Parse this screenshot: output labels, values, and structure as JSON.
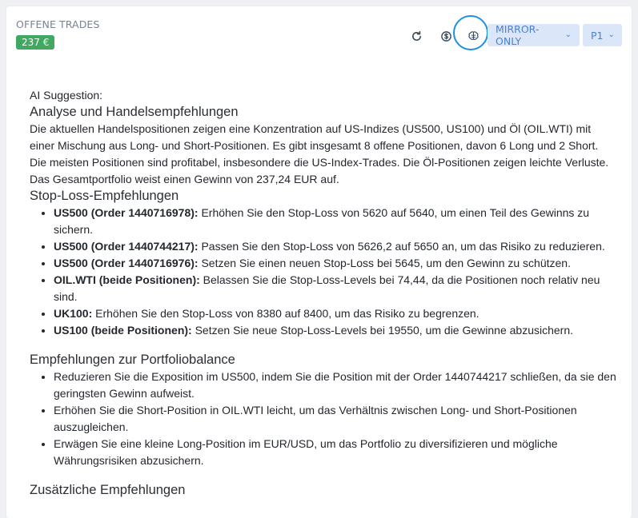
{
  "header": {
    "title": "OFFENE TRADES",
    "badge": "237 €"
  },
  "toolbar": {
    "refresh_icon": "refresh-icon",
    "currency_icon": "currency-exchange-icon",
    "ai_icon": "brain-ai-icon",
    "mode_dropdown": "MIRROR-ONLY",
    "profile_dropdown": "P1"
  },
  "suggestion": {
    "label": "AI Suggestion:",
    "heading_analysis": "Analyse und Handelsempfehlungen",
    "analysis_text": "Die aktuellen Handelspositionen zeigen eine Konzentration auf US-Indizes (US500, US100) und Öl (OIL.WTI) mit einer Mischung aus Long- und Short-Positionen. Es gibt insgesamt 8 offene Positionen, davon 6 Long und 2 Short. Die meisten Positionen sind profitabel, insbesondere die US-Index-Trades. Die Öl-Positionen zeigen leichte Verluste. Das Gesamtportfolio weist einen Gewinn von 237,24 EUR auf.",
    "heading_stoploss": "Stop-Loss-Empfehlungen",
    "stoploss_items": [
      {
        "bold": "US500 (Order 1440716978):",
        "text": " Erhöhen Sie den Stop-Loss von 5620 auf 5640, um einen Teil des Gewinns zu sichern."
      },
      {
        "bold": "US500 (Order 1440744217):",
        "text": " Passen Sie den Stop-Loss von 5626,2 auf 5650 an, um das Risiko zu reduzieren."
      },
      {
        "bold": "US500 (Order 1440716976):",
        "text": " Setzen Sie einen neuen Stop-Loss bei 5645, um den Gewinn zu schützen."
      },
      {
        "bold": "OIL.WTI (beide Positionen):",
        "text": " Belassen Sie die Stop-Loss-Levels bei 74,44, da die Positionen noch relativ neu sind."
      },
      {
        "bold": "UK100:",
        "text": " Erhöhen Sie den Stop-Loss von 8380 auf 8400, um das Risiko zu begrenzen."
      },
      {
        "bold": "US100 (beide Positionen):",
        "text": " Setzen Sie neue Stop-Loss-Levels bei 19550, um die Gewinne abzusichern."
      }
    ],
    "heading_balance": "Empfehlungen zur Portfoliobalance",
    "balance_items": [
      "Reduzieren Sie die Exposition im US500, indem Sie die Position mit der Order 1440744217 schließen, da sie den geringsten Gewinn aufweist.",
      "Erhöhen Sie die Short-Position in OIL.WTI leicht, um das Verhältnis zwischen Long- und Short-Positionen auszugleichen.",
      "Erwägen Sie eine kleine Long-Position im EUR/USD, um das Portfolio zu diversifizieren und mögliche Währungsrisiken abzusichern."
    ],
    "heading_additional": "Zusätzliche Empfehlungen"
  }
}
